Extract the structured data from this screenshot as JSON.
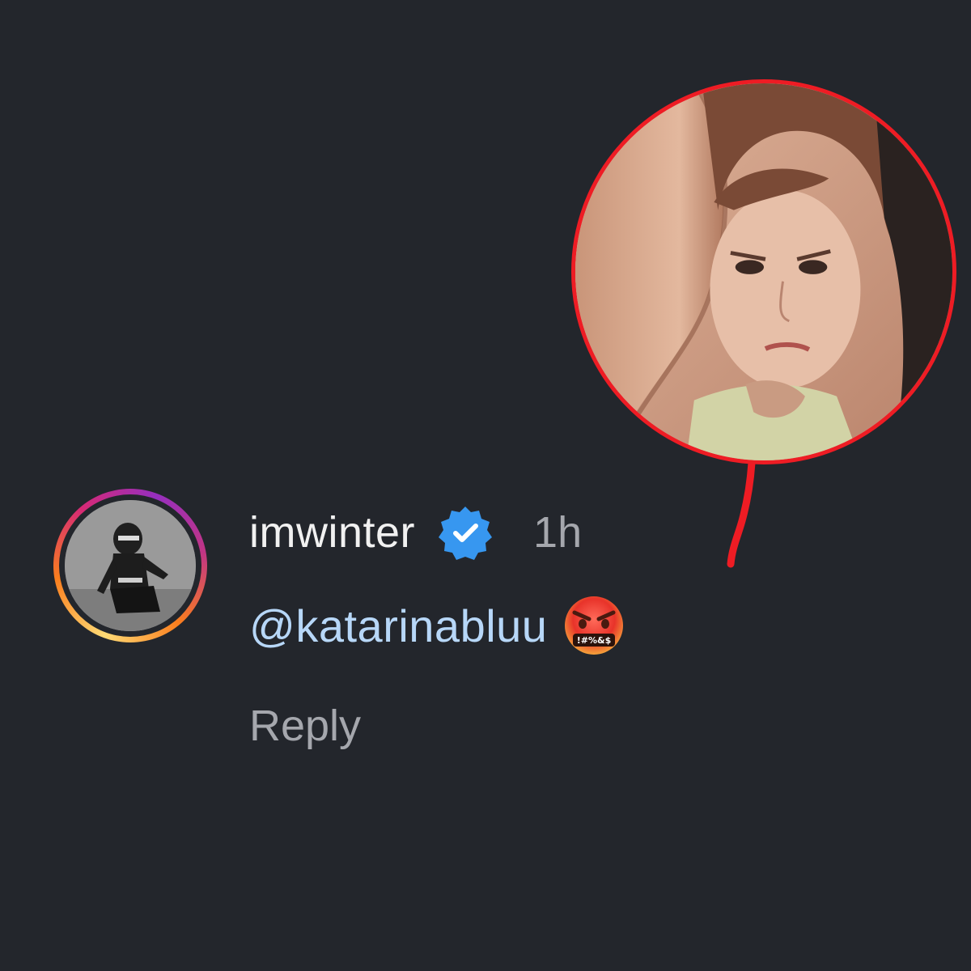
{
  "comment": {
    "username": "imwinter",
    "verified_icon": "verified-badge-icon",
    "timestamp": "1h",
    "text": "@katarinabluu",
    "emoji": "face-with-symbols-on-mouth-emoji",
    "emoji_symbols": "!#%&$",
    "reply_label": "Reply"
  },
  "colors": {
    "background": "#23262c",
    "username": "#f1f1f1",
    "mention": "#b7d7f8",
    "muted": "#a5a7ad",
    "verified": "#3797f0",
    "highlight_ring": "#ee1c24"
  }
}
